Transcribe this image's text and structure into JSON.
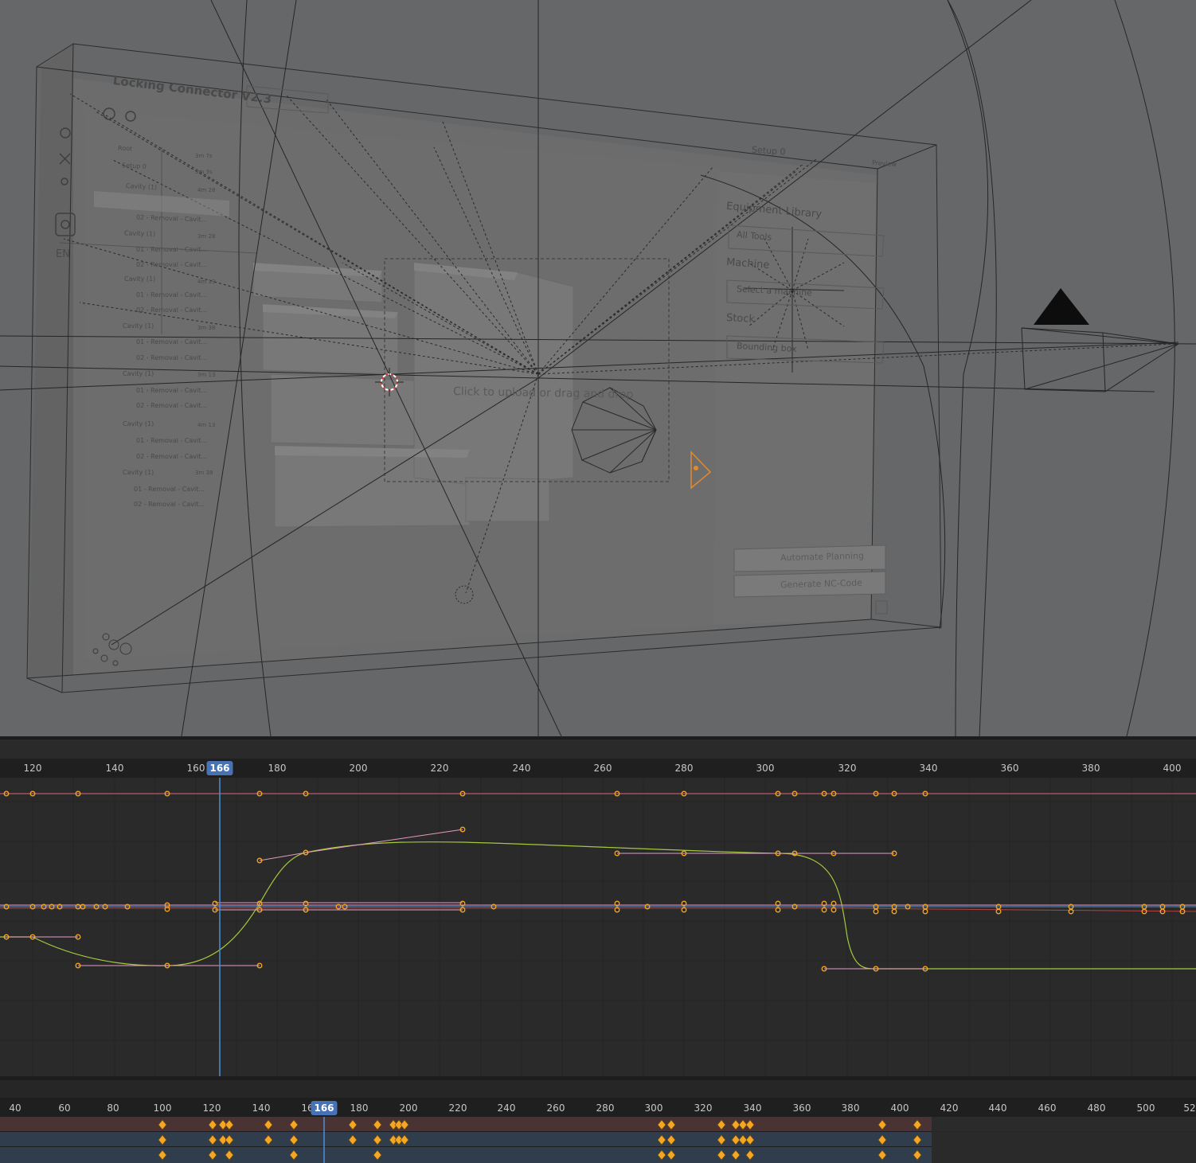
{
  "viewport": {
    "embedded_app": {
      "title": "Locking Connector V2.3",
      "tree": [
        {
          "label": "Root",
          "time": "3m 7s"
        },
        {
          "label": "Setup 0",
          "time": "3m 3s"
        },
        {
          "label": "Cavity (1)",
          "time": "4m 28"
        },
        {
          "label": "02 - Removal - Cavit...",
          "time": ""
        },
        {
          "label": "Cavity (1)",
          "time": "3m 28"
        },
        {
          "label": "01 - Removal - Cavit...",
          "time": ""
        },
        {
          "label": "02 - Removal - Cavit...",
          "time": ""
        },
        {
          "label": "Cavity (1)",
          "time": "4m 13"
        },
        {
          "label": "01 - Removal - Cavit...",
          "time": ""
        },
        {
          "label": "02 - Removal - Cavit...",
          "time": ""
        },
        {
          "label": "Cavity (1)",
          "time": "3m 38"
        },
        {
          "label": "01 - Removal - Cavit...",
          "time": ""
        },
        {
          "label": "02 - Removal - Cavit...",
          "time": ""
        },
        {
          "label": "Cavity (1)",
          "time": "3m 13"
        },
        {
          "label": "01 - Removal - Cavit...",
          "time": ""
        },
        {
          "label": "02 - Removal - Cavit...",
          "time": ""
        },
        {
          "label": "Cavity (1)",
          "time": "4m 13"
        },
        {
          "label": "01 - Removal - Cavit...",
          "time": ""
        },
        {
          "label": "02 - Removal - Cavit...",
          "time": ""
        },
        {
          "label": "Cavity (1)",
          "time": "3m 38"
        },
        {
          "label": "01 - Removal - Cavit...",
          "time": ""
        },
        {
          "label": "02 - Removal - Cavit...",
          "time": ""
        }
      ],
      "setup_label": "Setup 0",
      "preview_label": "Preview",
      "equipment_library": "Equipment Library",
      "all_tools": "All Tools",
      "machine": "Machine",
      "select_machine": "Select a machine",
      "stock": "Stock",
      "bounding_box": "Bounding box",
      "upload_text": "Click to upload or drag and drop",
      "automate_planning": "Automate Planning",
      "generate_nc": "Generate NC-Code",
      "lang": "EN"
    }
  },
  "graph_editor": {
    "current_frame": "166",
    "ticks": [
      "120",
      "140",
      "160",
      "180",
      "200",
      "220",
      "240",
      "260",
      "280",
      "300",
      "320",
      "340",
      "360",
      "380",
      "400"
    ]
  },
  "dopesheet": {
    "current_frame": "166",
    "ticks": [
      "40",
      "60",
      "80",
      "100",
      "120",
      "140",
      "16",
      "180",
      "200",
      "220",
      "240",
      "260",
      "280",
      "300",
      "320",
      "340",
      "360",
      "380",
      "400",
      "420",
      "440",
      "460",
      "480",
      "500",
      "52"
    ]
  },
  "colors": {
    "viewport_bg": "#666768",
    "editor_bg": "#2a2a2a",
    "playhead": "#4772b3",
    "keyframe": "#f5a623",
    "curve_green": "#a4c93c",
    "curve_red": "#d4474a",
    "curve_pink": "#e59ac1",
    "curve_blue": "#4d8fd6"
  }
}
